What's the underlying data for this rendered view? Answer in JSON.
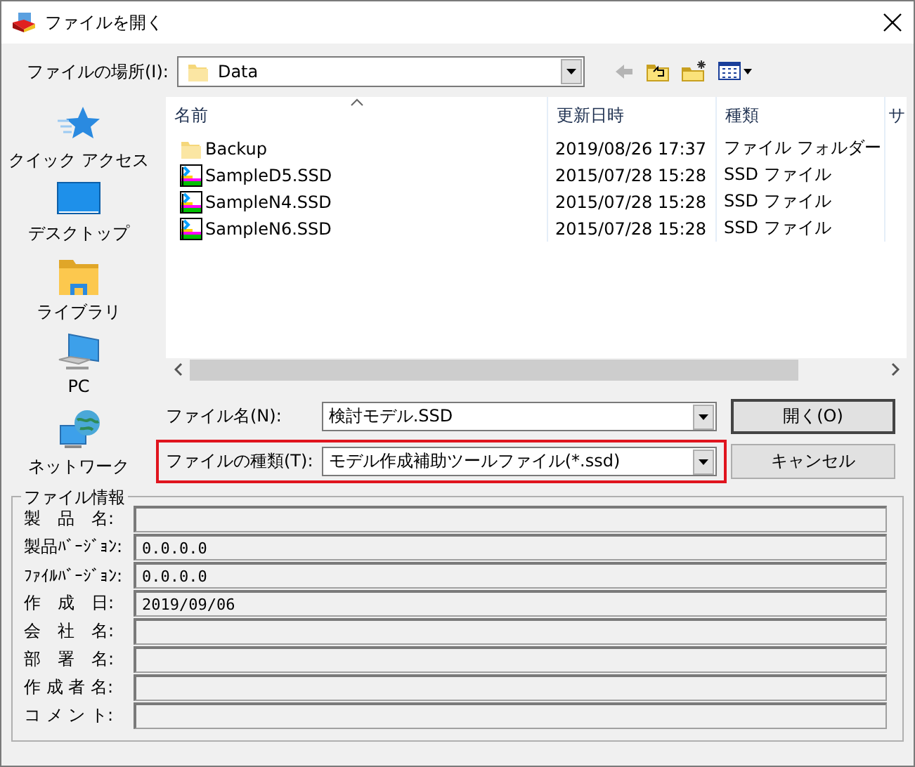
{
  "window": {
    "title": "ファイルを開く"
  },
  "location": {
    "label": "ファイルの場所(I):",
    "value": "Data"
  },
  "toolbar": [
    {
      "kind": "back",
      "disabled": true
    },
    {
      "kind": "up",
      "disabled": false
    },
    {
      "kind": "new_folder",
      "disabled": false
    },
    {
      "kind": "view",
      "disabled": false
    }
  ],
  "places": [
    {
      "kind": "quick",
      "label": "クイック アクセス"
    },
    {
      "kind": "desktop",
      "label": "デスクトップ"
    },
    {
      "kind": "library",
      "label": "ライブラリ"
    },
    {
      "kind": "pc",
      "label": "PC"
    },
    {
      "kind": "network",
      "label": "ネットワーク"
    }
  ],
  "file_list": {
    "columns": [
      {
        "label": "名前",
        "sorted": true
      },
      {
        "label": "更新日時",
        "sorted": false
      },
      {
        "label": "種類",
        "sorted": false
      },
      {
        "label": "サ",
        "sorted": false
      }
    ],
    "rows": [
      {
        "kind": "folder",
        "name": "Backup",
        "modified": "2019/08/26 17:37",
        "type": "ファイル フォルダー"
      },
      {
        "kind": "ssd",
        "name": "SampleD5.SSD",
        "modified": "2015/07/28 15:28",
        "type": "SSD ファイル"
      },
      {
        "kind": "ssd",
        "name": "SampleN4.SSD",
        "modified": "2015/07/28 15:28",
        "type": "SSD ファイル"
      },
      {
        "kind": "ssd",
        "name": "SampleN6.SSD",
        "modified": "2015/07/28 15:28",
        "type": "SSD ファイル"
      }
    ]
  },
  "file_name": {
    "label": "ファイル名(N):",
    "value": "検討モデル.SSD",
    "highlighted": false
  },
  "file_type": {
    "label": "ファイルの種類(T):",
    "value": "モデル作成補助ツールファイル(*.ssd)",
    "highlighted": true
  },
  "buttons": [
    {
      "label": "開く(O)",
      "default": true
    },
    {
      "label": "キャンセル",
      "default": false
    }
  ],
  "file_info": {
    "title": "ファイル情報",
    "fields": [
      {
        "label": "製　品　名:"
      },
      {
        "label": "製品ﾊﾞｰｼﾞｮﾝ:",
        "value": "0.0.0.0"
      },
      {
        "label": "ﾌｧｲﾙﾊﾞｰｼﾞｮﾝ:",
        "value": "0.0.0.0"
      },
      {
        "label": "作　成　日:",
        "value": "2019/09/06"
      },
      {
        "label": "会　社　名:"
      },
      {
        "label": "部　署　名:"
      },
      {
        "label": "作 成 者 名:"
      },
      {
        "label": "コ メ ン ト:"
      }
    ]
  }
}
